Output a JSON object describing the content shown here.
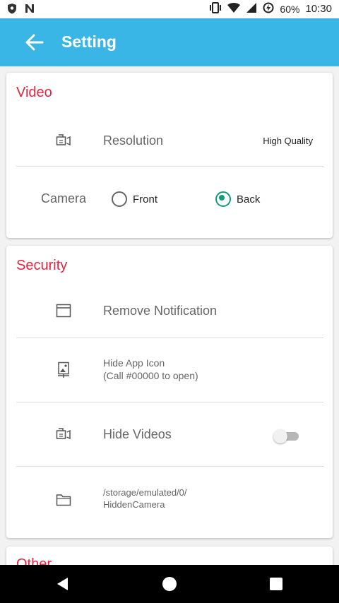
{
  "statusbar": {
    "battery": "60%",
    "time": "10:30"
  },
  "appbar": {
    "title": "Setting"
  },
  "video": {
    "title": "Video",
    "resolution_label": "Resolution",
    "resolution_value": "High Quality",
    "camera_label": "Camera",
    "camera_options": [
      {
        "label": "Front",
        "selected": false
      },
      {
        "label": "Back",
        "selected": true
      }
    ]
  },
  "security": {
    "title": "Security",
    "remove_notification": "Remove Notification",
    "hide_app_icon": "Hide App Icon",
    "hide_app_icon_hint": "(Call #00000 to open)",
    "hide_videos": "Hide Videos",
    "hide_videos_enabled": false,
    "storage_path_1": "/storage/emulated/0/",
    "storage_path_2": "HiddenCamera"
  },
  "other": {
    "title": "Other"
  },
  "colors": {
    "appbar": "#39b6e5",
    "section_title": "#e8233f",
    "radio_selected": "#119d78"
  }
}
